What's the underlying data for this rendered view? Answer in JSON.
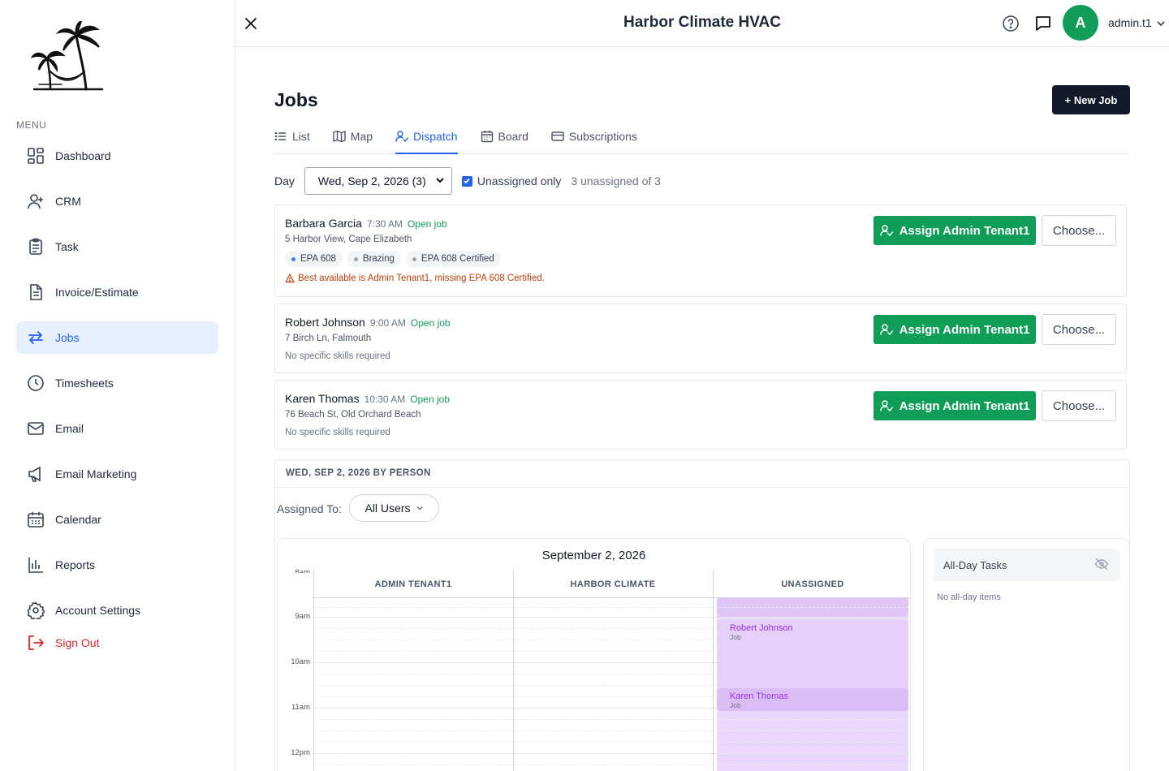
{
  "app": {
    "title": "Harbor Climate HVAC",
    "user": "admin.t1",
    "avatar_initial": "A"
  },
  "sidebar": {
    "menu_label": "MENU",
    "items": [
      {
        "label": "Dashboard",
        "icon": "dashboard-icon"
      },
      {
        "label": "CRM",
        "icon": "add-user-icon"
      },
      {
        "label": "Task",
        "icon": "clipboard-icon"
      },
      {
        "label": "Invoice/Estimate",
        "icon": "document-icon"
      },
      {
        "label": "Jobs",
        "icon": "swap-arrows-icon",
        "active": true
      },
      {
        "label": "Timesheets",
        "icon": "clock-icon"
      },
      {
        "label": "Email",
        "icon": "mail-icon"
      },
      {
        "label": "Email Marketing",
        "icon": "megaphone-icon"
      },
      {
        "label": "Calendar",
        "icon": "calendar-icon"
      },
      {
        "label": "Reports",
        "icon": "bar-chart-icon"
      },
      {
        "label": "Account Settings",
        "icon": "gear-icon"
      }
    ],
    "signout_label": "Sign Out"
  },
  "page": {
    "title": "Jobs",
    "new_job_label": "+ New Job",
    "tabs": [
      {
        "label": "List",
        "icon": "list-icon"
      },
      {
        "label": "Map",
        "icon": "map-icon"
      },
      {
        "label": "Dispatch",
        "icon": "person-check-icon",
        "active": true
      },
      {
        "label": "Board",
        "icon": "calendar-icon"
      },
      {
        "label": "Subscriptions",
        "icon": "card-icon"
      }
    ]
  },
  "filters": {
    "day_label": "Day",
    "day_value": "Wed, Sep 2, 2026 (3)",
    "unassigned_only_label": "Unassigned only",
    "unassigned_only_checked": true,
    "count_text": "3 unassigned of 3"
  },
  "jobs": [
    {
      "name": "Barbara Garcia",
      "time": "7:30 AM",
      "status": "Open job",
      "address": "5 Harbor View, Cape Elizabeth",
      "chips": [
        {
          "label": "EPA 608",
          "dot": "#3b82f6"
        },
        {
          "label": "Brazing",
          "dot": "#9ca3af"
        },
        {
          "label": "EPA 608 Certified",
          "dot": "#9ca3af"
        }
      ],
      "warning": "Best available is Admin Tenant1, missing EPA 608 Certified.",
      "assign_label": "Assign Admin Tenant1",
      "choose_label": "Choose..."
    },
    {
      "name": "Robert Johnson",
      "time": "9:00 AM",
      "status": "Open job",
      "address": "7 Birch Ln, Falmouth",
      "note": "No specific skills required",
      "assign_label": "Assign Admin Tenant1",
      "choose_label": "Choose..."
    },
    {
      "name": "Karen Thomas",
      "time": "10:30 AM",
      "status": "Open job",
      "address": "76 Beach St, Old Orchard Beach",
      "note": "No specific skills required",
      "assign_label": "Assign Admin Tenant1",
      "choose_label": "Choose..."
    }
  ],
  "calendar": {
    "section_title": "WED, SEP 2, 2026 BY PERSON",
    "assigned_to_label": "Assigned To:",
    "assigned_to_value": "All Users",
    "date_title": "September 2, 2026",
    "columns": [
      "ADMIN TENANT1",
      "HARBOR CLIMATE",
      "UNASSIGNED"
    ],
    "time_labels": [
      "8am",
      "9am",
      "10am",
      "11am",
      "12pm"
    ],
    "events": [
      {
        "title": "Robert Johnson",
        "sub": "Job"
      },
      {
        "title": "Karen Thomas",
        "sub": "Job"
      }
    ],
    "allday_title": "All-Day Tasks",
    "allday_empty": "No all-day items"
  },
  "colors": {
    "accent": "#2563eb",
    "success": "#0f9d58",
    "event": "#ead7fb",
    "warning": "#c2410c",
    "danger": "#dc2626"
  }
}
